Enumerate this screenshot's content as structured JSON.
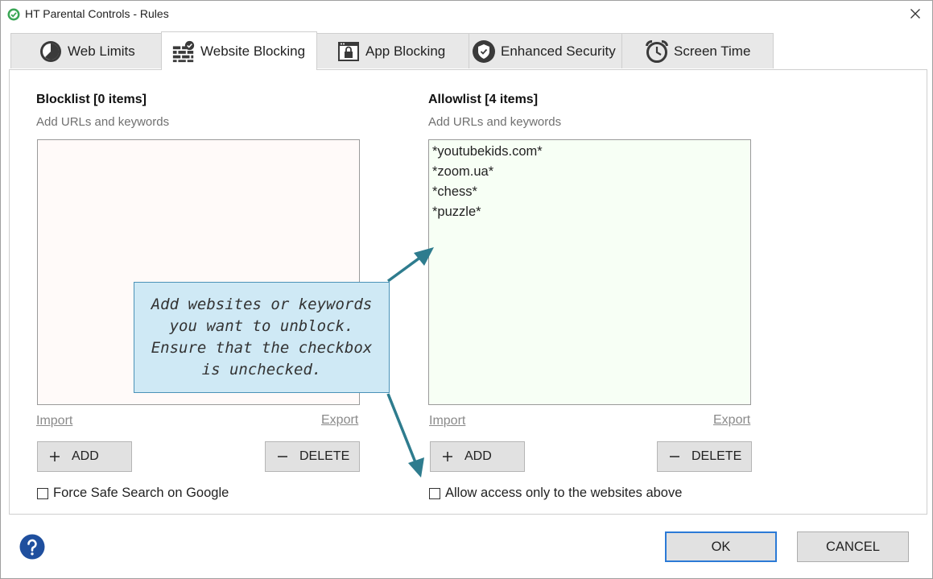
{
  "window": {
    "title": "HT Parental Controls - Rules"
  },
  "tabs": [
    {
      "label": "Web Limits",
      "icon": "pie-clock-icon"
    },
    {
      "label": "Website Blocking",
      "icon": "firewall-check-icon"
    },
    {
      "label": "App Blocking",
      "icon": "window-lock-icon"
    },
    {
      "label": "Enhanced Security",
      "icon": "shield-check-icon"
    },
    {
      "label": "Screen Time",
      "icon": "alarm-clock-icon"
    }
  ],
  "blocklist": {
    "title": "Blocklist [0 items]",
    "subtitle": "Add URLs and keywords",
    "items": [],
    "import_label": "Import",
    "export_label": "Export",
    "add_label": "ADD",
    "delete_label": "DELETE",
    "checkbox_label": "Force Safe Search on Google",
    "checked": false
  },
  "allowlist": {
    "title": "Allowlist [4 items]",
    "subtitle": "Add URLs and keywords",
    "items": [
      "*youtubekids.com*",
      "*zoom.ua*",
      "*chess*",
      "*puzzle*"
    ],
    "import_label": "Import",
    "export_label": "Export",
    "add_label": "ADD",
    "delete_label": "DELETE",
    "checkbox_label": "Allow access only to the websites above",
    "checked": false
  },
  "callout": {
    "text": "Add websites or keywords you want to unblock. Ensure that the checkbox is unchecked."
  },
  "footer": {
    "ok_label": "OK",
    "cancel_label": "CANCEL"
  },
  "colors": {
    "accent": "#2b7ad6",
    "callout_bg": "#cfe9f5",
    "arrow": "#2e7c8e",
    "help": "#1f4f9e"
  }
}
